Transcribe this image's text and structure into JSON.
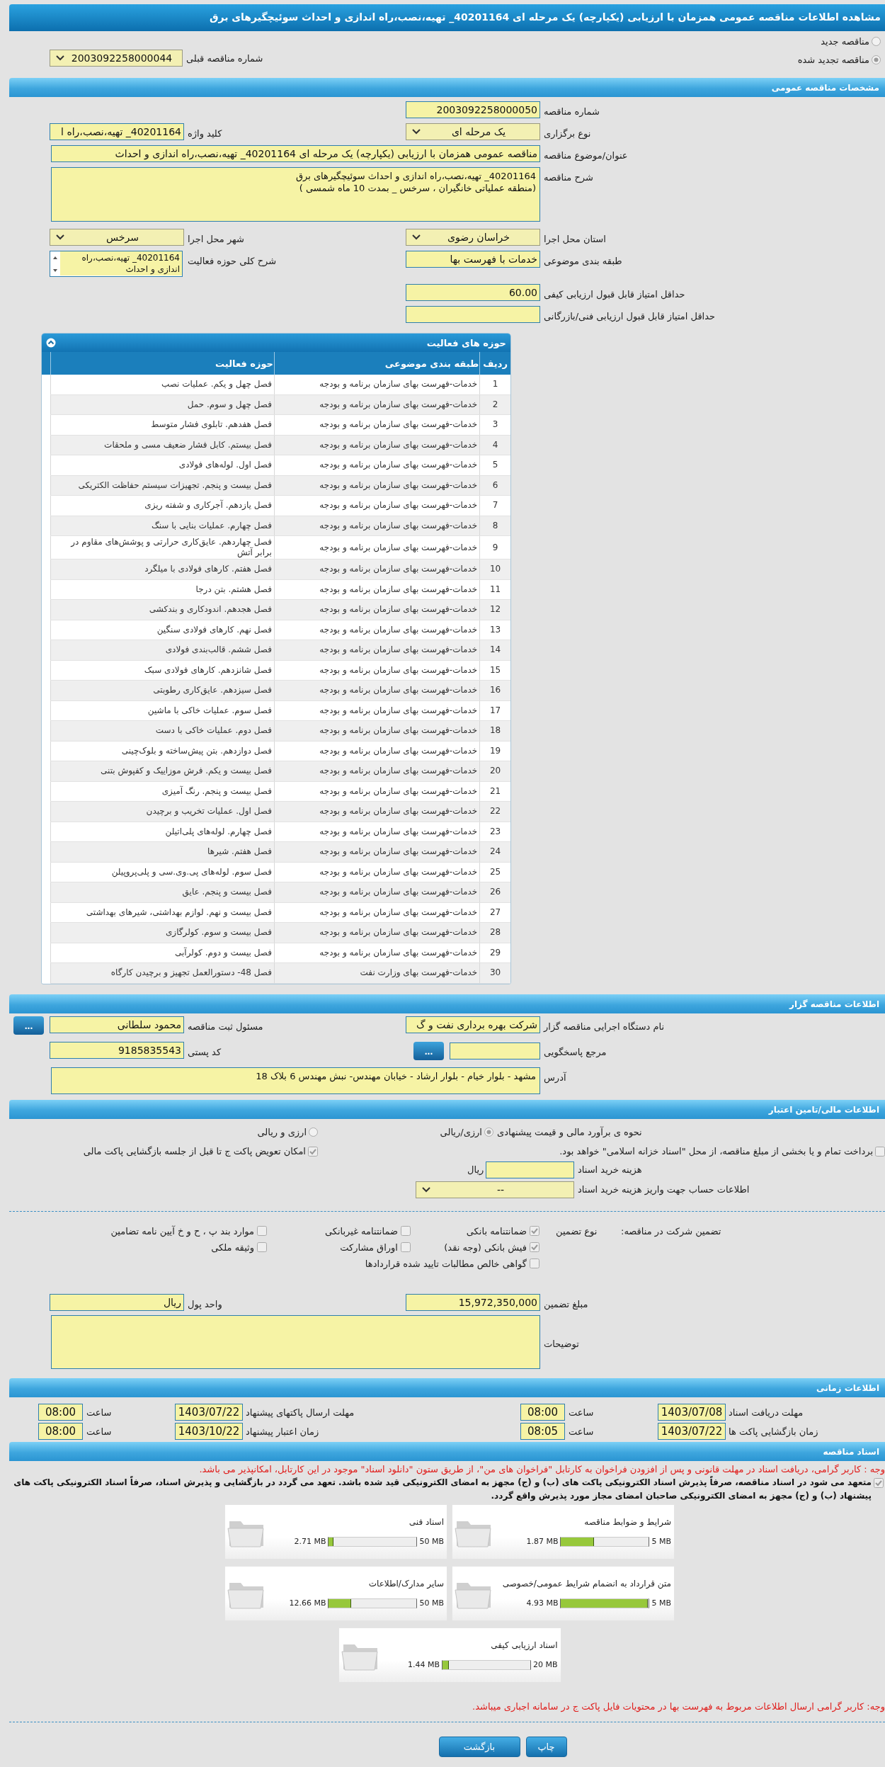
{
  "title": "مشاهده اطلاعات مناقصه عمومی همزمان با ارزیابی (یکپارچه) یک مرحله ای 40201164_ تهیه،نصب،راه اندازی و احداث سوئیچگیرهای برق",
  "tender_mode": [
    {
      "label": "مناقصه جدید",
      "selected": false
    },
    {
      "label": "مناقصه تجدید شده",
      "selected": true
    }
  ],
  "previous_tender": {
    "label": "شماره مناقصه قبلی",
    "value": "2003092258000044"
  },
  "general": {
    "heading": "مشخصات مناقصه عمومی",
    "rows": [
      {
        "right": {
          "label": "شماره مناقصه",
          "kind": "input",
          "value": "2003092258000050"
        }
      },
      {
        "right": {
          "label": "نوع برگزاری",
          "kind": "select",
          "value": "یک مرحله ای"
        },
        "left": {
          "label": "کلید واژه",
          "kind": "input",
          "value": "40201164_ تهیه،نصب،راه ا"
        }
      },
      {
        "right": {
          "label": "عنوان/موضوع مناقصه",
          "kind": "wide",
          "value": "مناقصه عمومی همزمان با ارزیابی (یکپارچه) یک مرحله ای 40201164_ تهیه،نصب،راه اندازی و احداث"
        }
      },
      {
        "right": {
          "label": "شرح مناقصه",
          "kind": "textarea",
          "value": "40201164_ تهیه،نصب،راه اندازی و احداث سوئیچگیرهای برق\n(منطقه عملیاتی خانگیران ، سرخس _ بمدت 10 ماه شمسی )"
        }
      },
      {
        "right": {
          "label": "استان محل اجرا",
          "kind": "select",
          "value": "خراسان رضوی"
        },
        "left": {
          "label": "شهر محل اجرا",
          "kind": "select",
          "value": "سرخس"
        }
      },
      {
        "right": {
          "label": "طبقه بندی موضوعی",
          "kind": "input",
          "value": "خدمات با فهرست بها"
        },
        "left": {
          "label": "شرح کلی حوزه فعالیت",
          "kind": "listbox",
          "value": "40201164_ تهیه،نصب،راه اندازی و احداث"
        }
      },
      {
        "right": {
          "label": "حداقل امتیاز قابل قبول ارزیابی کیفی",
          "kind": "input",
          "value": "60.00"
        }
      },
      {
        "right": {
          "label": "حداقل امتیاز قابل قبول ارزیابی فنی/بازرگانی",
          "kind": "input"
        }
      }
    ]
  },
  "activities": {
    "heading": "حوزه های فعالیت",
    "columns": [
      "ردیف",
      "طبقه بندی موضوعی",
      "حوزه فعالیت"
    ],
    "rows": [
      [
        "1",
        "خدمات-فهرست بهای سازمان برنامه و بودجه",
        "فصل چهل و یکم. عملیات نصب"
      ],
      [
        "2",
        "خدمات-فهرست بهای سازمان برنامه و بودجه",
        "فصل چهل و سوم. حمل"
      ],
      [
        "3",
        "خدمات-فهرست بهای سازمان برنامه و بودجه",
        "فصل هفدهم. تابلوی فشار متوسط"
      ],
      [
        "4",
        "خدمات-فهرست بهای سازمان برنامه و بودجه",
        "فصل بیستم. کابل فشار ضعیف مسی و ملحقات"
      ],
      [
        "5",
        "خدمات-فهرست بهای سازمان برنامه و بودجه",
        "فصل اول. لوله‌های فولادی"
      ],
      [
        "6",
        "خدمات-فهرست بهای سازمان برنامه و بودجه",
        "فصل بیست و پنجم. تجهیزات سیستم حفاظت الکتریکی"
      ],
      [
        "7",
        "خدمات-فهرست بهای سازمان برنامه و بودجه",
        "فصل یازدهم. آجرکاری و شفته ریزی"
      ],
      [
        "8",
        "خدمات-فهرست بهای سازمان برنامه و بودجه",
        "فصل چهارم. عملیات بنایی با سنگ"
      ],
      [
        "9",
        "خدمات-فهرست بهای سازمان برنامه و بودجه",
        "فصل چهاردهم. عایق‌کاری حرارتی و پوشش‌های مقاوم در برابر آتش"
      ],
      [
        "10",
        "خدمات-فهرست بهای سازمان برنامه و بودجه",
        "فصل هفتم. کارهای فولادی با میلگرد"
      ],
      [
        "11",
        "خدمات-فهرست بهای سازمان برنامه و بودجه",
        "فصل هشتم. بتن درجا"
      ],
      [
        "12",
        "خدمات-فهرست بهای سازمان برنامه و بودجه",
        "فصل هجدهم. اندودکاری و بندکشی"
      ],
      [
        "13",
        "خدمات-فهرست بهای سازمان برنامه و بودجه",
        "فصل نهم. کارهای فولادی سنگین"
      ],
      [
        "14",
        "خدمات-فهرست بهای سازمان برنامه و بودجه",
        "فصل ششم. قالب‌بندی فولادی"
      ],
      [
        "15",
        "خدمات-فهرست بهای سازمان برنامه و بودجه",
        "فصل شانزدهم. کارهای فولادی سبک"
      ],
      [
        "16",
        "خدمات-فهرست بهای سازمان برنامه و بودجه",
        "فصل سیزدهم. عایق‌کاری رطوبتی"
      ],
      [
        "17",
        "خدمات-فهرست بهای سازمان برنامه و بودجه",
        "فصل سوم. عملیات خاکی با ماشین"
      ],
      [
        "18",
        "خدمات-فهرست بهای سازمان برنامه و بودجه",
        "فصل دوم. عملیات خاکی با دست"
      ],
      [
        "19",
        "خدمات-فهرست بهای سازمان برنامه و بودجه",
        "فصل دوازدهم. بتن پیش‌ساخته و بلوک‌چینی"
      ],
      [
        "20",
        "خدمات-فهرست بهای سازمان برنامه و بودجه",
        "فصل بیست و یکم. فرش موزاییک و کفپوش بتنی"
      ],
      [
        "21",
        "خدمات-فهرست بهای سازمان برنامه و بودجه",
        "فصل بیست و پنجم. رنگ آمیزی"
      ],
      [
        "22",
        "خدمات-فهرست بهای سازمان برنامه و بودجه",
        "فصل اول. عملیات تخریب و برچیدن"
      ],
      [
        "23",
        "خدمات-فهرست بهای سازمان برنامه و بودجه",
        "فصل چهارم. لوله‌های پلی‌اتیلن"
      ],
      [
        "24",
        "خدمات-فهرست بهای سازمان برنامه و بودجه",
        "فصل هفتم. شیرها"
      ],
      [
        "25",
        "خدمات-فهرست بهای سازمان برنامه و بودجه",
        "فصل سوم. لوله‌های پی.وی.سی و پلی‌پروپیلن"
      ],
      [
        "26",
        "خدمات-فهرست بهای سازمان برنامه و بودجه",
        "فصل بیست و پنجم. عایق"
      ],
      [
        "27",
        "خدمات-فهرست بهای سازمان برنامه و بودجه",
        "فصل بیست و نهم. لوازم بهداشتی، شیرهای بهداشتی"
      ],
      [
        "28",
        "خدمات-فهرست بهای سازمان برنامه و بودجه",
        "فصل بیست و سوم. کولرگازی"
      ],
      [
        "29",
        "خدمات-فهرست بهای سازمان برنامه و بودجه",
        "فصل بیست و دوم. کولرآبی"
      ],
      [
        "30",
        "خدمات-فهرست بهای وزارت نفت",
        "فصل 48- دستورالعمل تجهیز و برچیدن کارگاه"
      ]
    ]
  },
  "organizer": {
    "heading": "اطلاعات مناقصه گزار",
    "rows": [
      {
        "right": {
          "label": "نام دستگاه اجرایی مناقصه گزار",
          "kind": "input",
          "value": "شرکت بهره برداری نفت و گ"
        },
        "left": {
          "label": "مسئول ثبت مناقصه",
          "kind": "input",
          "value": "محمود سلطانی",
          "button": "..."
        }
      },
      {
        "right": {
          "label": "مرجع پاسخگویی",
          "kind": "input",
          "button": "..."
        },
        "left": {
          "label": "کد پستی",
          "kind": "input",
          "value": "9185835543"
        }
      },
      {
        "right": {
          "label": "آدرس",
          "kind": "textarea",
          "value": "مشهد - بلوار خیام - بلوار ارشاد - خیابان مهندس- نبش مهندس 6 بلاک 18"
        }
      }
    ]
  },
  "finance": {
    "heading": "اطلاعات مالی/تامین اعتبار",
    "estimate": {
      "label": "نحوه ی برآورد مالی و قیمت پیشنهادی",
      "options": [
        {
          "label": "ارزی/ریالی",
          "selected": true
        },
        {
          "label": "ارزی و ریالی",
          "selected": false
        }
      ]
    },
    "treasury": {
      "label": "برداخت تمام و یا بخشی از مبلغ مناقصه، از محل \"اسناد خزانه اسلامی\" خواهد بود.",
      "checked": false
    },
    "swap": {
      "label": "امکان تعویض پاکت ج تا قبل از جلسه بازگشایی پاکت مالی",
      "checked": true
    },
    "doc_cost": {
      "label": "هزینه خرید اسناد",
      "unit": "ریال"
    },
    "account": {
      "label": "اطلاعات حساب جهت واریز هزینه خرید اسناد",
      "value": "--"
    }
  },
  "guarantee": {
    "label": "تضمین شرکت در مناقصه:",
    "type_label": "نوع تضمین",
    "options": [
      {
        "label": "ضمانتنامه بانکی",
        "checked": true
      },
      {
        "label": "ضمانتنامه غیربانکی",
        "checked": false
      },
      {
        "label": "موارد بند پ ، ح و خ آیین نامه تضامین",
        "checked": false
      },
      {
        "label": "فیش بانکی (وجه نقد)",
        "checked": true
      },
      {
        "label": "اوراق مشارکت",
        "checked": false
      },
      {
        "label": "وثیقه ملکی",
        "checked": false
      },
      {
        "label": "گواهی خالص مطالبات تایید شده قراردادها",
        "checked": false
      }
    ],
    "amount": {
      "label": "مبلغ تضمین",
      "value": "15,972,350,000"
    },
    "currency": {
      "label": "واحد پول",
      "value": "ریال"
    },
    "notes": {
      "label": "توضیحات"
    }
  },
  "timing": {
    "heading": "اطلاعات زمانی",
    "rows": [
      [
        {
          "label": "مهلت دریافت اسناد",
          "date": "1403/07/08",
          "time_label": "ساعت",
          "time": "08:00"
        },
        {
          "label": "مهلت ارسال پاکتهای پیشنهاد",
          "date": "1403/07/22",
          "time_label": "ساعت",
          "time": "08:00"
        }
      ],
      [
        {
          "label": "زمان بازگشایی پاکت ها",
          "date": "1403/07/22",
          "time_label": "ساعت",
          "time": "08:05"
        },
        {
          "label": "زمان اعتبار پیشنهاد",
          "date": "1403/10/22",
          "time_label": "ساعت",
          "time": "08:00"
        }
      ]
    ]
  },
  "documents": {
    "heading": "اسناد مناقصه",
    "notice": "وجه : کاربر گرامی، دریافت اسناد در مهلت قانونی و پس از افزودن فراخوان به کارتابل \"فراخوان های من\"، از طریق ستون \"دانلود اسناد\" موجود در این کارتابل، امکانپذیر می باشد.",
    "commitment": {
      "text": "متعهد می شود در اسناد مناقصه، صرفاً پذیرش اسناد الکترونیکی پاکت های (ب) و (ج) مجهز به امضای الکترونیکی قید شده باشد. تعهد می گردد در بازگشایی و پذیرش اسناد، صرفاً اسناد الکترونیکی پاکت های پیشنهاد (ب) و (ج) مجهز به امضای الکترونیکی صاحبان امضای مجاز مورد پذیرش واقع گردد.",
      "checked": true
    },
    "files": [
      {
        "name": "شرایط و ضوابط مناقصه",
        "size": "1.87 MB",
        "max": "5 MB",
        "level": 0.374
      },
      {
        "name": "اسناد فنی",
        "size": "2.71 MB",
        "max": "50 MB",
        "level": 0.054
      },
      {
        "name": "متن قرارداد به انضمام شرایط عمومی/خصوصی",
        "size": "4.93 MB",
        "max": "5 MB",
        "level": 0.986
      },
      {
        "name": "سایر مدارک/اطلاعات",
        "size": "12.66 MB",
        "max": "50 MB",
        "level": 0.253
      },
      {
        "name": "اسناد ارزیابی کیفی",
        "size": "1.44 MB",
        "max": "20 MB",
        "level": 0.072
      }
    ]
  },
  "footer_note": "وجه: کاربر گرامی ارسال اطلاعات مربوط به فهرست بها در محتویات فایل پاکت ج در سامانه اجباری میباشد.",
  "buttons": [
    "چاپ",
    "بازگشت"
  ]
}
